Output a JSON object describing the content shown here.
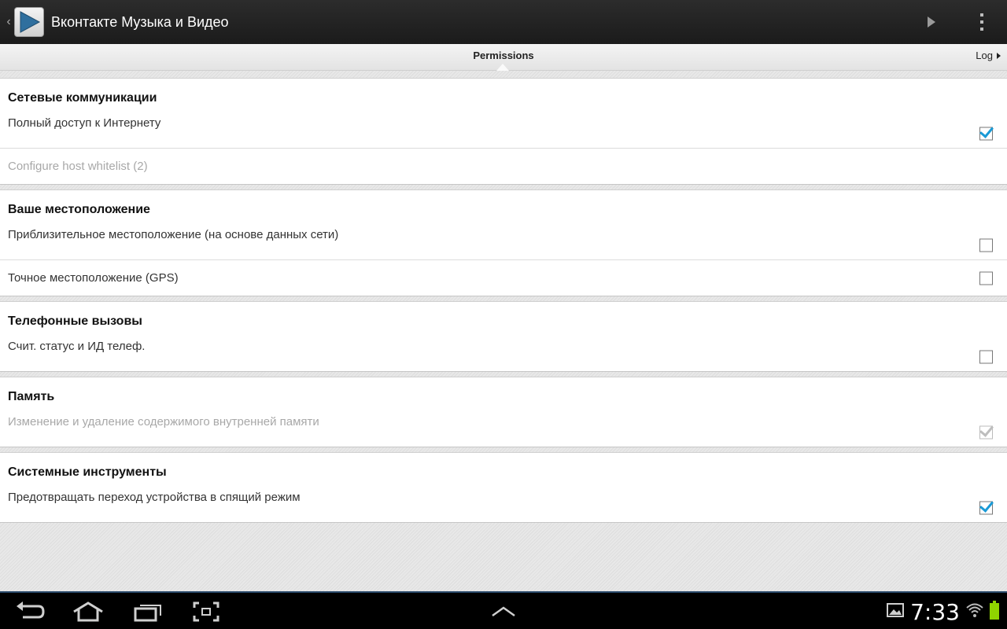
{
  "app": {
    "title": "Вконтакте Музыка и Видео",
    "icon": "play-app-icon"
  },
  "actions": {
    "play_icon": "play-icon",
    "overflow_icon": "overflow-menu-icon"
  },
  "tabs": {
    "current": "Permissions",
    "next": "Log"
  },
  "groups": [
    {
      "header": "Сетевые коммуникации",
      "rows": [
        {
          "label": "Полный доступ к Интернету",
          "checked": true,
          "disabled": false
        },
        {
          "label": "Configure host whitelist (2)",
          "link": true
        }
      ]
    },
    {
      "header": "Ваше местоположение",
      "rows": [
        {
          "label": "Приблизительное местоположение (на основе данных сети)",
          "checked": false,
          "disabled": false
        },
        {
          "label": "Точное местоположение (GPS)",
          "checked": false,
          "disabled": false
        }
      ]
    },
    {
      "header": "Телефонные вызовы",
      "rows": [
        {
          "label": "Счит. статус и ИД телеф.",
          "checked": false,
          "disabled": false
        }
      ]
    },
    {
      "header": "Память",
      "rows": [
        {
          "label": "Изменение и удаление содержимого внутренней памяти",
          "checked": true,
          "disabled": true
        }
      ]
    },
    {
      "header": "Системные инструменты",
      "rows": [
        {
          "label": "Предотвращать переход устройства в спящий режим",
          "checked": true,
          "disabled": false
        }
      ]
    }
  ],
  "status": {
    "time": "7:33",
    "battery_color": "#8fd400",
    "accent": "#1a9ad6"
  },
  "nav": [
    "back-icon",
    "home-icon",
    "recent-apps-icon",
    "screenshot-icon",
    "up-chevron-icon"
  ]
}
